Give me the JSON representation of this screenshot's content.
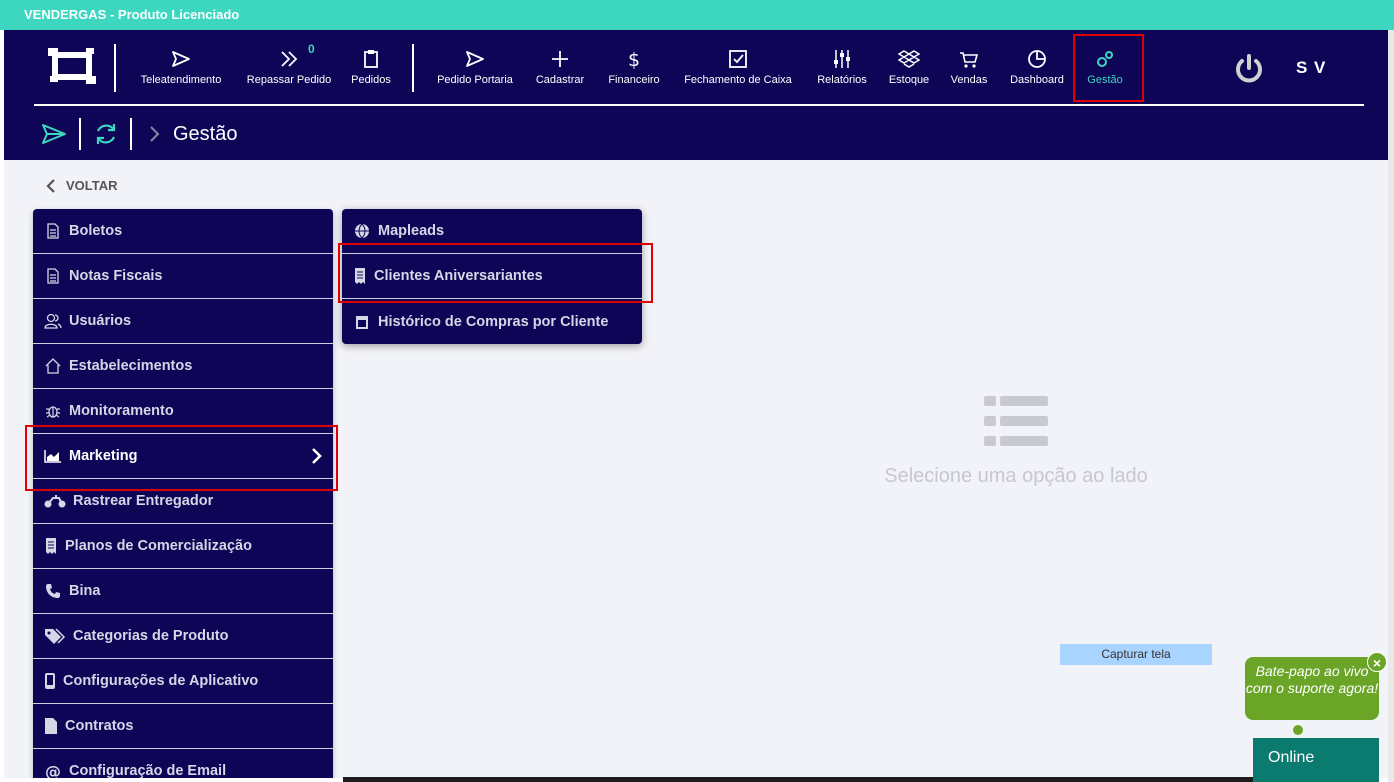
{
  "titlebar": {
    "text": "VENDERGAS - Produto Licenciado"
  },
  "nav": [
    {
      "label": "Teleatendimento",
      "icon": "send-icon"
    },
    {
      "label": "Repassar Pedido",
      "icon": "double-chevron-icon",
      "badge": "0"
    },
    {
      "label": "Pedidos",
      "icon": "clipboard-icon"
    },
    {
      "label": "Pedido Portaria",
      "icon": "send-icon"
    },
    {
      "label": "Cadastrar",
      "icon": "plus-icon"
    },
    {
      "label": "Financeiro",
      "icon": "dollar-icon"
    },
    {
      "label": "Fechamento de Caixa",
      "icon": "checkbox-icon"
    },
    {
      "label": "Relatórios",
      "icon": "sliders-icon"
    },
    {
      "label": "Estoque",
      "icon": "dropbox-icon"
    },
    {
      "label": "Vendas",
      "icon": "cart-icon"
    },
    {
      "label": "Dashboard",
      "icon": "pie-chart-icon"
    },
    {
      "label": "Gestão",
      "icon": "gears-icon",
      "active": true
    }
  ],
  "user": {
    "initials": "S V"
  },
  "breadcrumb": {
    "title": "Gestão"
  },
  "back": {
    "label": "VOLTAR"
  },
  "menu": [
    {
      "label": "Boletos",
      "icon": "document-icon"
    },
    {
      "label": "Notas Fiscais",
      "icon": "document-icon"
    },
    {
      "label": "Usuários",
      "icon": "users-icon"
    },
    {
      "label": "Estabelecimentos",
      "icon": "home-icon"
    },
    {
      "label": "Monitoramento",
      "icon": "bug-icon"
    },
    {
      "label": "Marketing",
      "icon": "area-chart-icon",
      "selected": true
    },
    {
      "label": "Rastrear Entregador",
      "icon": "motorcycle-icon"
    },
    {
      "label": "Planos de Comercialização",
      "icon": "receipt-icon"
    },
    {
      "label": "Bina",
      "icon": "phone-icon"
    },
    {
      "label": "Categorias de Produto",
      "icon": "tags-icon"
    },
    {
      "label": "Configurações de Aplicativo",
      "icon": "mobile-icon"
    },
    {
      "label": "Contratos",
      "icon": "file-icon"
    },
    {
      "label": "Configuração de Email",
      "icon": "at-icon"
    }
  ],
  "submenu": [
    {
      "label": "Mapleads",
      "icon": "globe-icon"
    },
    {
      "label": "Clientes Aniversariantes",
      "icon": "receipt-icon"
    },
    {
      "label": "Histórico de Compras por Cliente",
      "icon": "calendar-icon"
    }
  ],
  "empty_state": {
    "text": "Selecione uma opção ao lado",
    "icon": "list-icon"
  },
  "capture": {
    "label": "Capturar tela"
  },
  "chat": {
    "bubble": "Bate-papo ao vivo com o suporte agora!",
    "close": "×",
    "status": "Online"
  },
  "colors": {
    "header": "#0f0557",
    "accent": "#3dd6bf",
    "highlight": "#e00000",
    "chat": "#6aa528"
  }
}
